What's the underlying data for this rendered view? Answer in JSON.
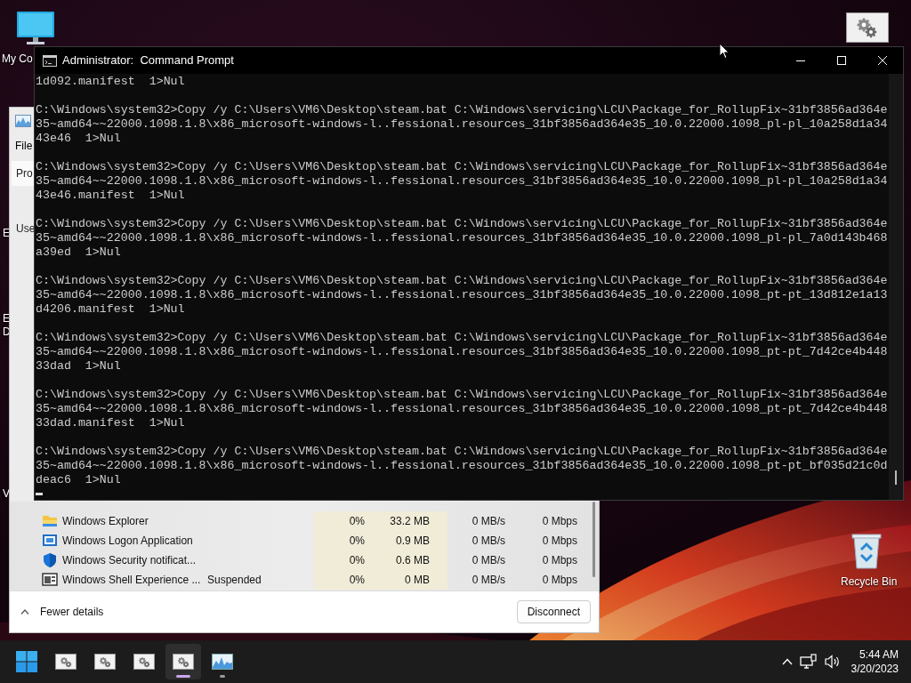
{
  "desktop": {
    "icons": [
      {
        "kind": "computer",
        "label": "My Co"
      },
      {
        "kind": "gear"
      },
      {
        "kind": "recycle",
        "label": "Recycle Bin"
      }
    ],
    "cut_labels": [
      "E",
      "E",
      "D",
      "V"
    ]
  },
  "task_manager": {
    "menu": [
      "File"
    ],
    "tabs": [
      {
        "label": "Pro",
        "selected": true
      },
      {
        "label": "Use",
        "selected": false
      }
    ],
    "rows": [
      {
        "kind": "folder",
        "name": "Windows Explorer",
        "cpu": "0%",
        "memory": "33.2 MB",
        "disk": "0 MB/s",
        "network": "0 Mbps"
      },
      {
        "kind": "logon",
        "name": "Windows Logon Application",
        "cpu": "0%",
        "memory": "0.9 MB",
        "disk": "0 MB/s",
        "network": "0 Mbps"
      },
      {
        "kind": "shield",
        "name": "Windows Security notificat...",
        "cpu": "0%",
        "memory": "0.6 MB",
        "disk": "0 MB/s",
        "network": "0 Mbps"
      },
      {
        "kind": "shell",
        "name": "Windows Shell Experience ...",
        "status": "Suspended",
        "cpu": "0%",
        "memory": "0 MB",
        "disk": "0 MB/s",
        "network": "0 Mbps"
      }
    ],
    "footer": {
      "toggle": "Fewer details",
      "button": "Disconnect"
    }
  },
  "console": {
    "title": "Administrator:  Command Prompt",
    "blocks": [
      [
        "1d092.manifest  1>Nul"
      ],
      [
        "C:\\Windows\\system32>Copy /y C:\\Users\\VM6\\Desktop\\steam.bat C:\\Windows\\servicing\\LCU\\Package_for_RollupFix~31bf3856ad364e",
        "35~amd64~~22000.1098.1.8\\x86_microsoft-windows-l..fessional.resources_31bf3856ad364e35_10.0.22000.1098_pl-pl_10a258d1a34",
        "43e46  1>Nul"
      ],
      [
        "C:\\Windows\\system32>Copy /y C:\\Users\\VM6\\Desktop\\steam.bat C:\\Windows\\servicing\\LCU\\Package_for_RollupFix~31bf3856ad364e",
        "35~amd64~~22000.1098.1.8\\x86_microsoft-windows-l..fessional.resources_31bf3856ad364e35_10.0.22000.1098_pl-pl_10a258d1a34",
        "43e46.manifest  1>Nul"
      ],
      [
        "C:\\Windows\\system32>Copy /y C:\\Users\\VM6\\Desktop\\steam.bat C:\\Windows\\servicing\\LCU\\Package_for_RollupFix~31bf3856ad364e",
        "35~amd64~~22000.1098.1.8\\x86_microsoft-windows-l..fessional.resources_31bf3856ad364e35_10.0.22000.1098_pl-pl_7a0d143b468",
        "a39ed  1>Nul"
      ],
      [
        "C:\\Windows\\system32>Copy /y C:\\Users\\VM6\\Desktop\\steam.bat C:\\Windows\\servicing\\LCU\\Package_for_RollupFix~31bf3856ad364e",
        "35~amd64~~22000.1098.1.8\\x86_microsoft-windows-l..fessional.resources_31bf3856ad364e35_10.0.22000.1098_pt-pt_13d812e1a13",
        "d4206.manifest  1>Nul"
      ],
      [
        "C:\\Windows\\system32>Copy /y C:\\Users\\VM6\\Desktop\\steam.bat C:\\Windows\\servicing\\LCU\\Package_for_RollupFix~31bf3856ad364e",
        "35~amd64~~22000.1098.1.8\\x86_microsoft-windows-l..fessional.resources_31bf3856ad364e35_10.0.22000.1098_pt-pt_7d42ce4b448",
        "33dad  1>Nul"
      ],
      [
        "C:\\Windows\\system32>Copy /y C:\\Users\\VM6\\Desktop\\steam.bat C:\\Windows\\servicing\\LCU\\Package_for_RollupFix~31bf3856ad364e",
        "35~amd64~~22000.1098.1.8\\x86_microsoft-windows-l..fessional.resources_31bf3856ad364e35_10.0.22000.1098_pt-pt_7d42ce4b448",
        "33dad.manifest  1>Nul"
      ],
      [
        "C:\\Windows\\system32>Copy /y C:\\Users\\VM6\\Desktop\\steam.bat C:\\Windows\\servicing\\LCU\\Package_for_RollupFix~31bf3856ad364e",
        "35~amd64~~22000.1098.1.8\\x86_microsoft-windows-l..fessional.resources_31bf3856ad364e35_10.0.22000.1098_pt-pt_bf035d21c0d",
        "deac6  1>Nul"
      ]
    ]
  },
  "taskbar": {
    "apps": [
      {
        "kind": "gear",
        "active": false,
        "running": false
      },
      {
        "kind": "gear",
        "active": false,
        "running": false
      },
      {
        "kind": "gear",
        "active": false,
        "running": false
      },
      {
        "kind": "gear",
        "active": true,
        "running": true
      },
      {
        "kind": "monitor",
        "active": false,
        "running": true
      }
    ],
    "clock": {
      "time": "5:44 AM",
      "date": "3/20/2023"
    }
  }
}
